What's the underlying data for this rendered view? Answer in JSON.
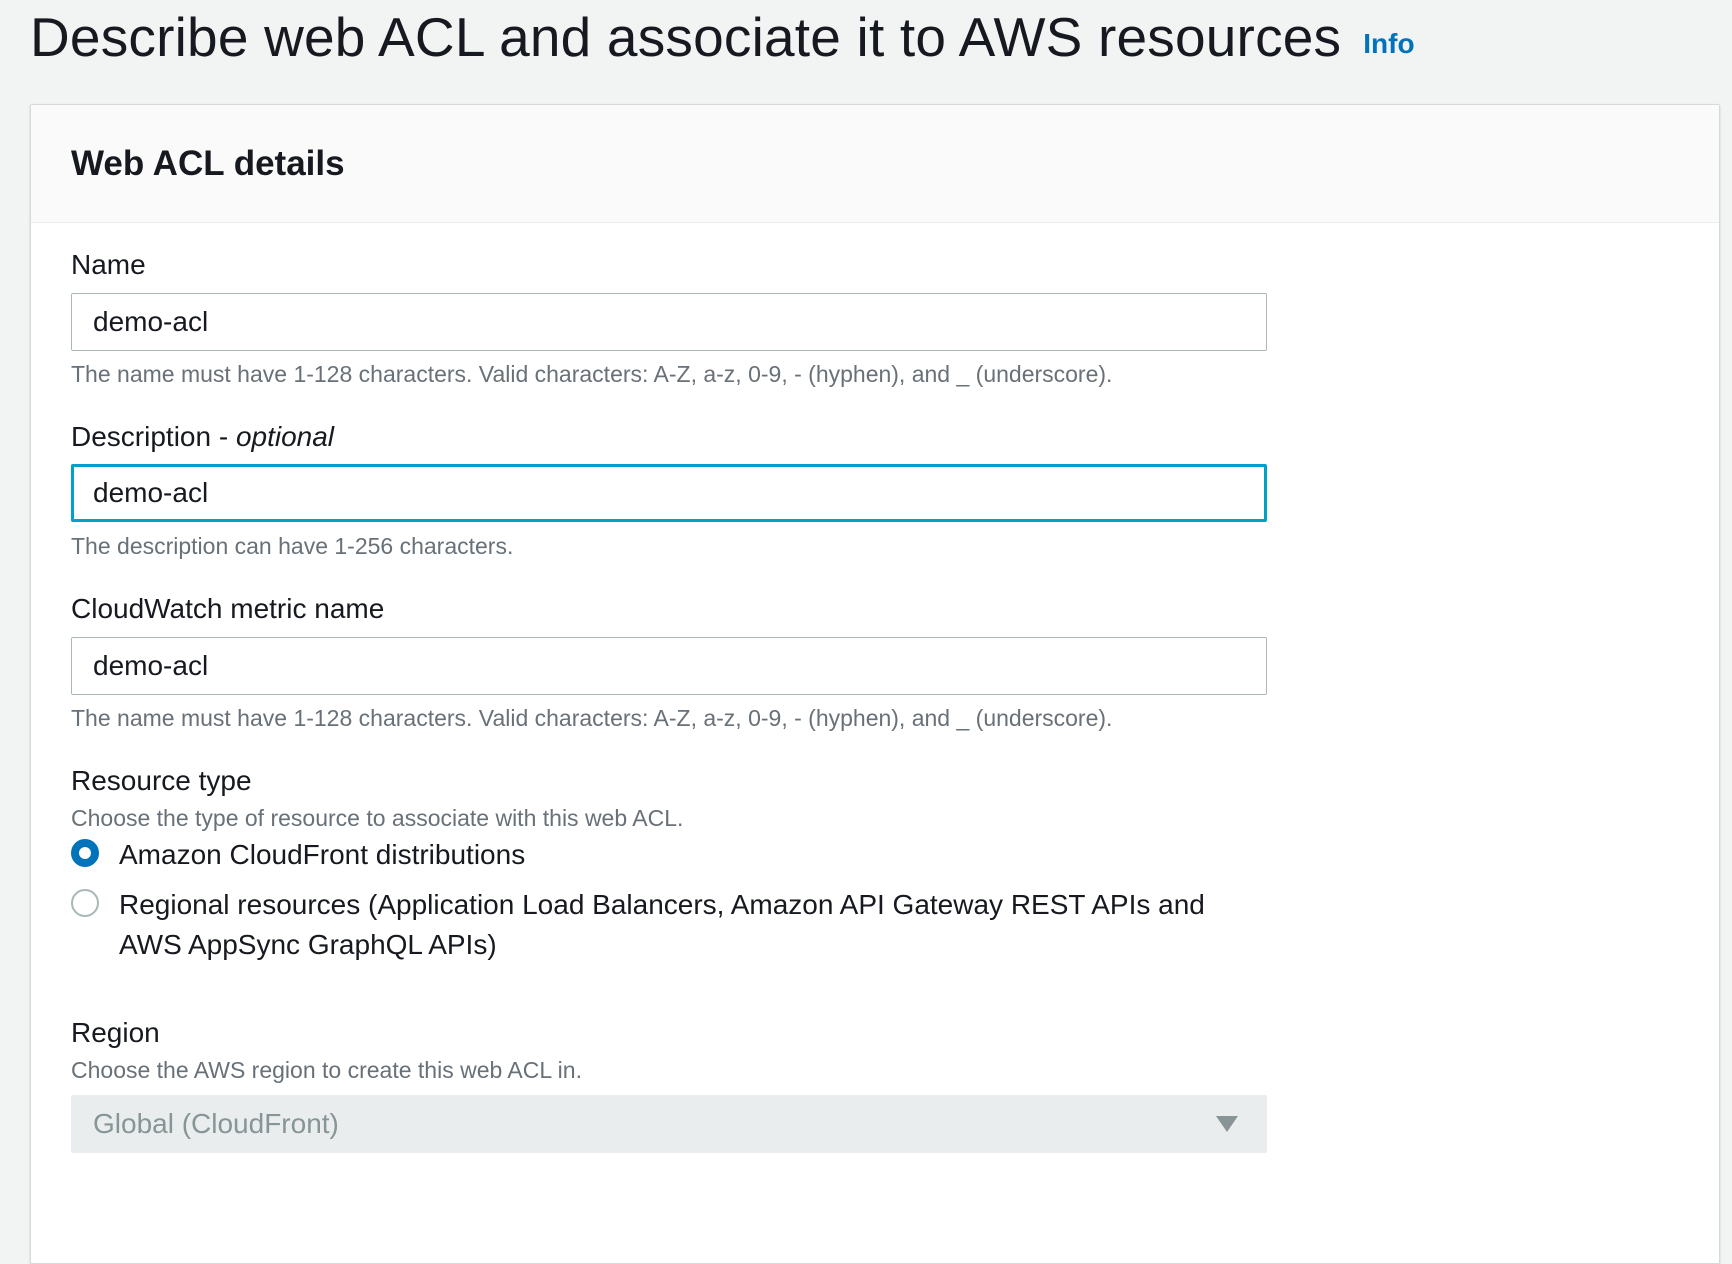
{
  "header": {
    "title": "Describe web ACL and associate it to AWS resources",
    "info_link": "Info"
  },
  "panel": {
    "title": "Web ACL details"
  },
  "name_field": {
    "label": "Name",
    "value": "demo-acl",
    "hint": "The name must have 1-128 characters. Valid characters: A-Z, a-z, 0-9, - (hyphen), and _ (underscore)."
  },
  "description_field": {
    "label": "Description - ",
    "label_optional": "optional",
    "value": "demo-acl",
    "hint": "The description can have 1-256 characters."
  },
  "metric_field": {
    "label": "CloudWatch metric name",
    "value": "demo-acl",
    "hint": "The name must have 1-128 characters. Valid characters: A-Z, a-z, 0-9, - (hyphen), and _ (underscore)."
  },
  "resource_type": {
    "label": "Resource type",
    "description": "Choose the type of resource to associate with this web ACL.",
    "options": [
      {
        "label": "Amazon CloudFront distributions",
        "selected": true
      },
      {
        "label": "Regional resources (Application Load Balancers, Amazon API Gateway REST APIs and AWS AppSync GraphQL APIs)",
        "selected": false
      }
    ]
  },
  "region": {
    "label": "Region",
    "description": "Choose the AWS region to create this web ACL in.",
    "selected_value": "Global (CloudFront)",
    "disabled": true
  },
  "colors": {
    "accent": "#0073bb",
    "focus": "#00a1c9",
    "text": "#16191f",
    "hint": "#687078",
    "background": "#f2f3f3"
  }
}
